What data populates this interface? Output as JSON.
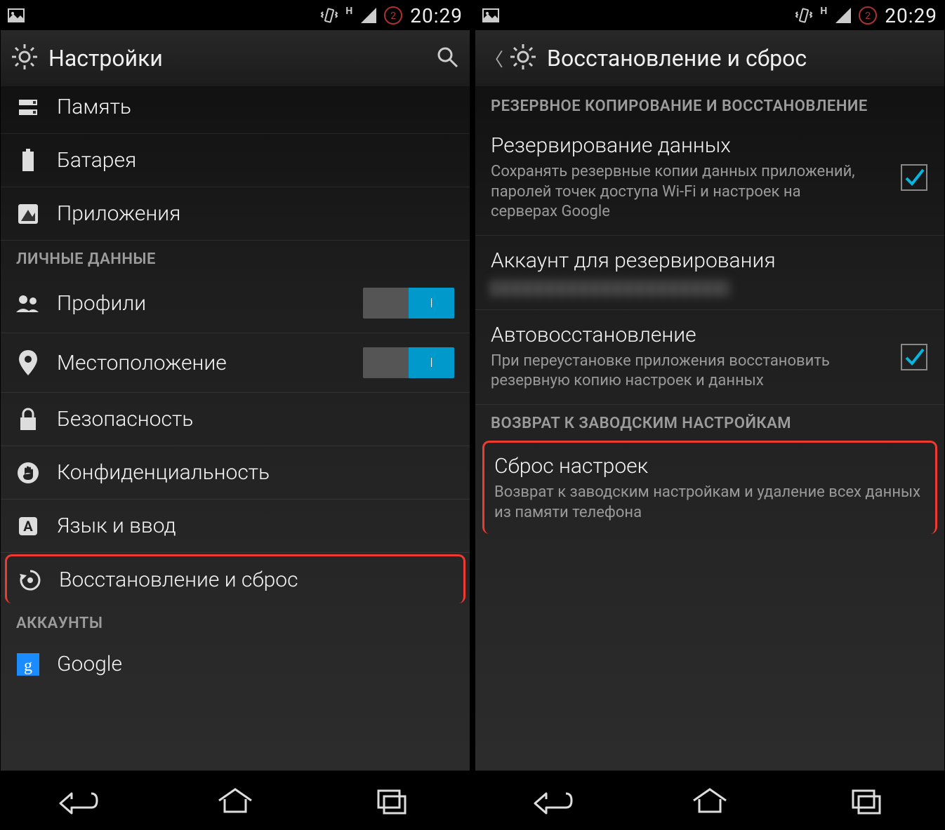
{
  "status": {
    "time": "20:29",
    "net_letter": "H"
  },
  "s1": {
    "appbar_title": "Настройки",
    "items": [
      {
        "label": "Память"
      },
      {
        "label": "Батарея"
      },
      {
        "label": "Приложения"
      }
    ],
    "section_personal": "ЛИЧНЫЕ ДАННЫЕ",
    "personal": [
      {
        "label": "Профили",
        "toggle_text": "I"
      },
      {
        "label": "Местоположение",
        "toggle_text": "I"
      },
      {
        "label": "Безопасность"
      },
      {
        "label": "Конфиденциальность"
      },
      {
        "label": "Язык и ввод"
      },
      {
        "label": "Восстановление и сброс"
      }
    ],
    "section_accounts": "АККАУНТЫ",
    "accounts": [
      {
        "label": "Google"
      }
    ]
  },
  "s2": {
    "appbar_title": "Восстановление и сброс",
    "section_backup": "РЕЗЕРВНОЕ КОПИРОВАНИЕ И ВОССТАНОВЛЕНИЕ",
    "backup": {
      "title": "Резервирование данных",
      "sub": "Сохранять резервные копии данных приложений, паролей точек доступа Wi-Fi и настроек на серверах Google"
    },
    "account": {
      "title": "Аккаунт для резервирования"
    },
    "autorestore": {
      "title": "Автовосстановление",
      "sub": "При переустановке приложения восстановить резервную копию настроек и данных"
    },
    "section_reset": "ВОЗВРАТ К ЗАВОДСКИМ НАСТРОЙКАМ",
    "reset": {
      "title": "Сброс настроек",
      "sub": "Возврат к заводским настройкам и удаление всех данных из памяти телефона"
    }
  }
}
